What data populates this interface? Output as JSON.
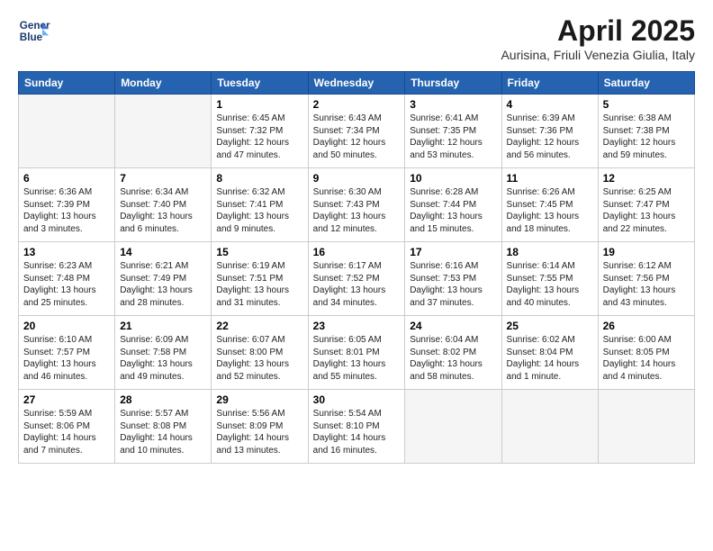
{
  "header": {
    "logo_line1": "General",
    "logo_line2": "Blue",
    "month_title": "April 2025",
    "location": "Aurisina, Friuli Venezia Giulia, Italy"
  },
  "days_of_week": [
    "Sunday",
    "Monday",
    "Tuesday",
    "Wednesday",
    "Thursday",
    "Friday",
    "Saturday"
  ],
  "weeks": [
    [
      {
        "day": "",
        "info": ""
      },
      {
        "day": "",
        "info": ""
      },
      {
        "day": "1",
        "info": "Sunrise: 6:45 AM\nSunset: 7:32 PM\nDaylight: 12 hours and 47 minutes."
      },
      {
        "day": "2",
        "info": "Sunrise: 6:43 AM\nSunset: 7:34 PM\nDaylight: 12 hours and 50 minutes."
      },
      {
        "day": "3",
        "info": "Sunrise: 6:41 AM\nSunset: 7:35 PM\nDaylight: 12 hours and 53 minutes."
      },
      {
        "day": "4",
        "info": "Sunrise: 6:39 AM\nSunset: 7:36 PM\nDaylight: 12 hours and 56 minutes."
      },
      {
        "day": "5",
        "info": "Sunrise: 6:38 AM\nSunset: 7:38 PM\nDaylight: 12 hours and 59 minutes."
      }
    ],
    [
      {
        "day": "6",
        "info": "Sunrise: 6:36 AM\nSunset: 7:39 PM\nDaylight: 13 hours and 3 minutes."
      },
      {
        "day": "7",
        "info": "Sunrise: 6:34 AM\nSunset: 7:40 PM\nDaylight: 13 hours and 6 minutes."
      },
      {
        "day": "8",
        "info": "Sunrise: 6:32 AM\nSunset: 7:41 PM\nDaylight: 13 hours and 9 minutes."
      },
      {
        "day": "9",
        "info": "Sunrise: 6:30 AM\nSunset: 7:43 PM\nDaylight: 13 hours and 12 minutes."
      },
      {
        "day": "10",
        "info": "Sunrise: 6:28 AM\nSunset: 7:44 PM\nDaylight: 13 hours and 15 minutes."
      },
      {
        "day": "11",
        "info": "Sunrise: 6:26 AM\nSunset: 7:45 PM\nDaylight: 13 hours and 18 minutes."
      },
      {
        "day": "12",
        "info": "Sunrise: 6:25 AM\nSunset: 7:47 PM\nDaylight: 13 hours and 22 minutes."
      }
    ],
    [
      {
        "day": "13",
        "info": "Sunrise: 6:23 AM\nSunset: 7:48 PM\nDaylight: 13 hours and 25 minutes."
      },
      {
        "day": "14",
        "info": "Sunrise: 6:21 AM\nSunset: 7:49 PM\nDaylight: 13 hours and 28 minutes."
      },
      {
        "day": "15",
        "info": "Sunrise: 6:19 AM\nSunset: 7:51 PM\nDaylight: 13 hours and 31 minutes."
      },
      {
        "day": "16",
        "info": "Sunrise: 6:17 AM\nSunset: 7:52 PM\nDaylight: 13 hours and 34 minutes."
      },
      {
        "day": "17",
        "info": "Sunrise: 6:16 AM\nSunset: 7:53 PM\nDaylight: 13 hours and 37 minutes."
      },
      {
        "day": "18",
        "info": "Sunrise: 6:14 AM\nSunset: 7:55 PM\nDaylight: 13 hours and 40 minutes."
      },
      {
        "day": "19",
        "info": "Sunrise: 6:12 AM\nSunset: 7:56 PM\nDaylight: 13 hours and 43 minutes."
      }
    ],
    [
      {
        "day": "20",
        "info": "Sunrise: 6:10 AM\nSunset: 7:57 PM\nDaylight: 13 hours and 46 minutes."
      },
      {
        "day": "21",
        "info": "Sunrise: 6:09 AM\nSunset: 7:58 PM\nDaylight: 13 hours and 49 minutes."
      },
      {
        "day": "22",
        "info": "Sunrise: 6:07 AM\nSunset: 8:00 PM\nDaylight: 13 hours and 52 minutes."
      },
      {
        "day": "23",
        "info": "Sunrise: 6:05 AM\nSunset: 8:01 PM\nDaylight: 13 hours and 55 minutes."
      },
      {
        "day": "24",
        "info": "Sunrise: 6:04 AM\nSunset: 8:02 PM\nDaylight: 13 hours and 58 minutes."
      },
      {
        "day": "25",
        "info": "Sunrise: 6:02 AM\nSunset: 8:04 PM\nDaylight: 14 hours and 1 minute."
      },
      {
        "day": "26",
        "info": "Sunrise: 6:00 AM\nSunset: 8:05 PM\nDaylight: 14 hours and 4 minutes."
      }
    ],
    [
      {
        "day": "27",
        "info": "Sunrise: 5:59 AM\nSunset: 8:06 PM\nDaylight: 14 hours and 7 minutes."
      },
      {
        "day": "28",
        "info": "Sunrise: 5:57 AM\nSunset: 8:08 PM\nDaylight: 14 hours and 10 minutes."
      },
      {
        "day": "29",
        "info": "Sunrise: 5:56 AM\nSunset: 8:09 PM\nDaylight: 14 hours and 13 minutes."
      },
      {
        "day": "30",
        "info": "Sunrise: 5:54 AM\nSunset: 8:10 PM\nDaylight: 14 hours and 16 minutes."
      },
      {
        "day": "",
        "info": ""
      },
      {
        "day": "",
        "info": ""
      },
      {
        "day": "",
        "info": ""
      }
    ]
  ]
}
